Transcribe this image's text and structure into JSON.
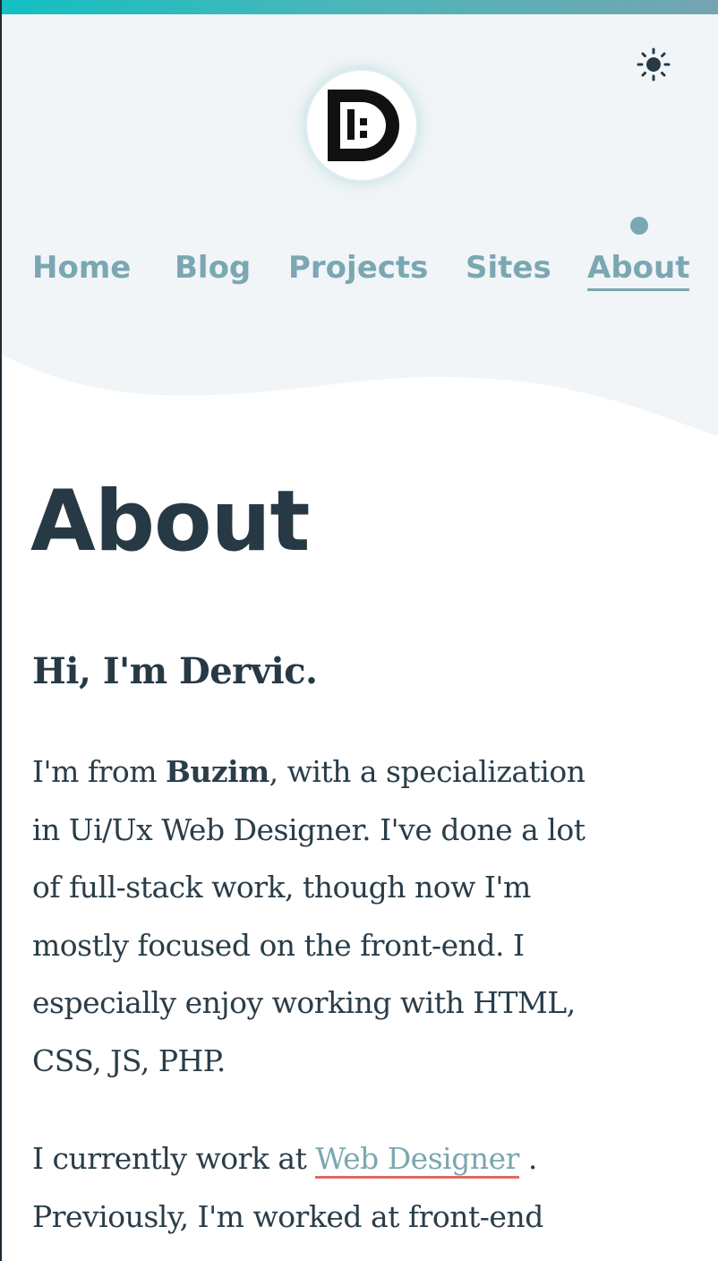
{
  "header": {
    "logo_icon": "dp-monogram-logo",
    "theme_icon": "sun-icon"
  },
  "nav": {
    "items": [
      {
        "label": "Home"
      },
      {
        "label": "Blog"
      },
      {
        "label": "Projects"
      },
      {
        "label": "Sites"
      },
      {
        "label": "About",
        "active": true
      }
    ]
  },
  "main": {
    "title": "About",
    "greeting": "Hi, I'm Dervic.",
    "para1": {
      "prefix": "I'm from ",
      "strong": "Buzim",
      "rest_line1": ", with a specialization",
      "line2": "in Ui/Ux Web Designer. I've done a lot",
      "line3": "of full-stack work, though now I'm",
      "line4": "mostly focused on the front-end. I",
      "line5": "especially enjoy working with HTML,",
      "line6": "CSS, JS, PHP."
    },
    "para2": {
      "prefix": "I currently work at ",
      "link": "Web Designer",
      "suffix": " .",
      "line2": "Previously, I'm worked at front-end"
    }
  },
  "colors": {
    "accent": "#7aa7b2",
    "heading": "#263945",
    "header_bg": "#f1f5f7",
    "link_underline": "#e06a63"
  }
}
